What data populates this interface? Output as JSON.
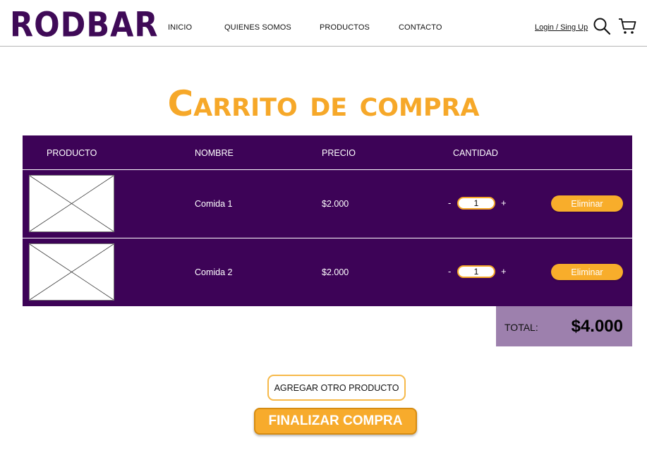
{
  "header": {
    "logo": "RODBAR",
    "nav": [
      "INICIO",
      "QUIENES SOMOS",
      "PRODUCTOS",
      "CONTACTO"
    ],
    "login": "Login / Sing Up",
    "icons": [
      "search-icon",
      "cart-icon"
    ]
  },
  "cart": {
    "title": "Carrito de compra",
    "columns": [
      "PRODUCTO",
      "NOMBRE",
      "PRECIO",
      "CANTIDAD"
    ],
    "rows": [
      {
        "name": "Comida 1",
        "price": "$2.000",
        "quantity": "1",
        "remove_label": "Eliminar"
      },
      {
        "name": "Comida 2",
        "price": "$2.000",
        "quantity": "1",
        "remove_label": "Eliminar"
      }
    ],
    "qty_minus": "-",
    "qty_plus": "+",
    "total_label": "TOTAL:",
    "total_value": "$4.000"
  },
  "actions": {
    "add_product": "AGREGAR OTRO PRODUCTO",
    "finish": "FINALIZAR COMPRA"
  },
  "colors": {
    "purple": "#3d0357",
    "orange": "#f6a829",
    "total_bg": "#9d80ad"
  }
}
